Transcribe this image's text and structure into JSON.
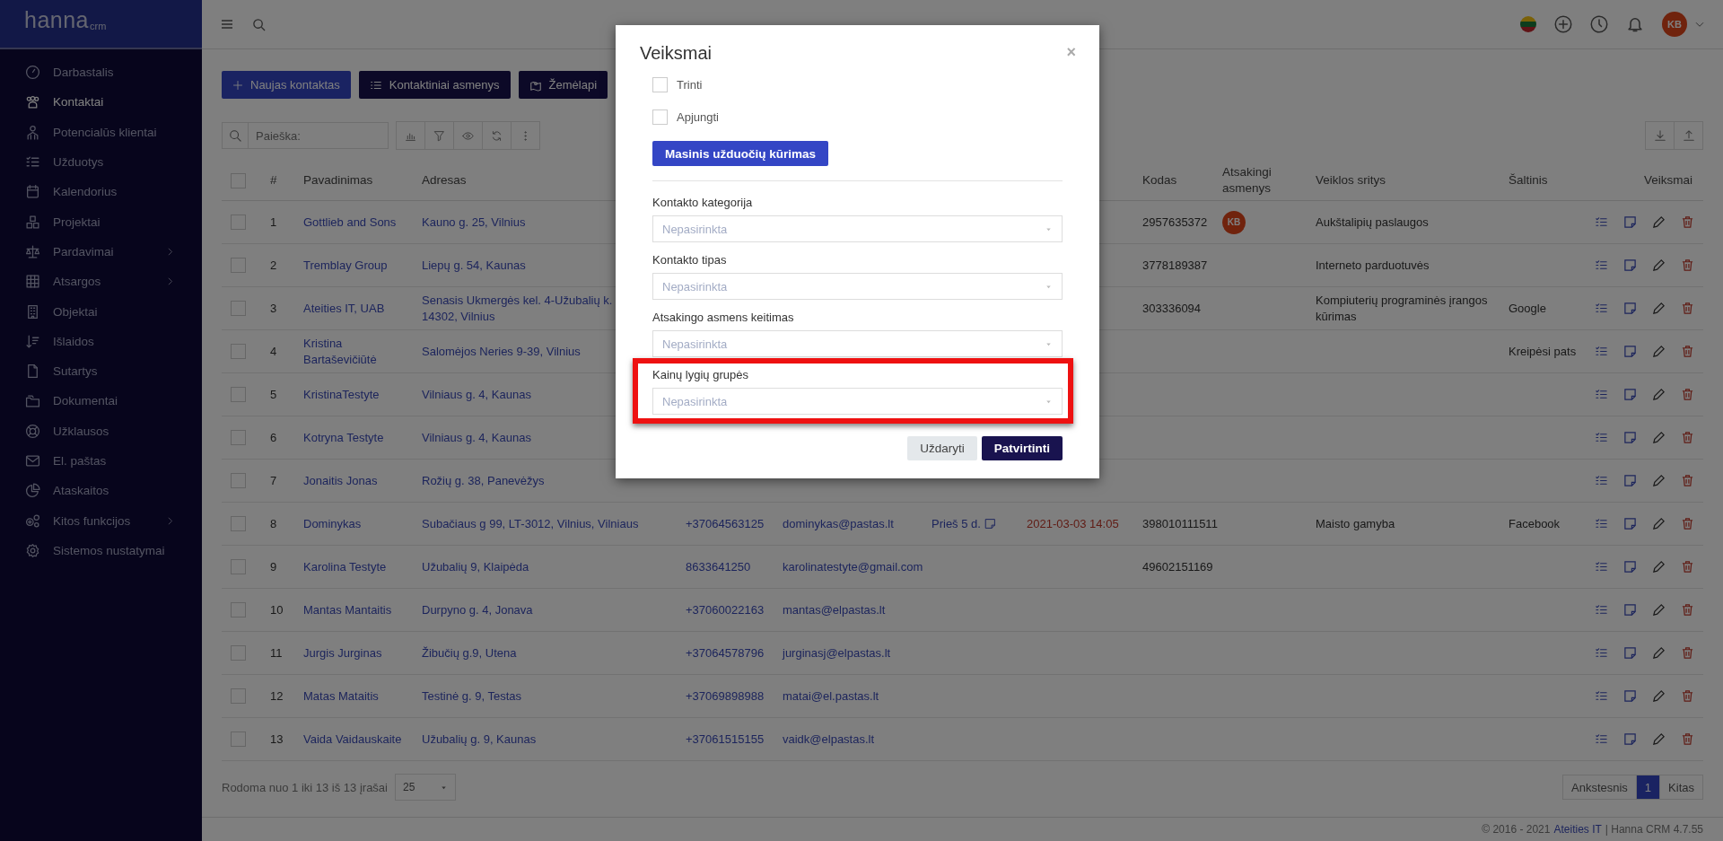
{
  "sidebar": {
    "logo": {
      "main": "hanna",
      "sub": "crm"
    },
    "items": [
      {
        "label": "Darbastalis",
        "selected": false,
        "has_submenu": false
      },
      {
        "label": "Kontaktai",
        "selected": true,
        "has_submenu": false
      },
      {
        "label": "Potencialūs klientai",
        "selected": false,
        "has_submenu": false
      },
      {
        "label": "Užduotys",
        "selected": false,
        "has_submenu": false
      },
      {
        "label": "Kalendorius",
        "selected": false,
        "has_submenu": false
      },
      {
        "label": "Projektai",
        "selected": false,
        "has_submenu": false
      },
      {
        "label": "Pardavimai",
        "selected": false,
        "has_submenu": true
      },
      {
        "label": "Atsargos",
        "selected": false,
        "has_submenu": true
      },
      {
        "label": "Objektai",
        "selected": false,
        "has_submenu": false
      },
      {
        "label": "Išlaidos",
        "selected": false,
        "has_submenu": false
      },
      {
        "label": "Sutartys",
        "selected": false,
        "has_submenu": false
      },
      {
        "label": "Dokumentai",
        "selected": false,
        "has_submenu": false
      },
      {
        "label": "Užklausos",
        "selected": false,
        "has_submenu": false
      },
      {
        "label": "El. paštas",
        "selected": false,
        "has_submenu": false
      },
      {
        "label": "Ataskaitos",
        "selected": false,
        "has_submenu": false
      },
      {
        "label": "Kitos funkcijos",
        "selected": false,
        "has_submenu": true
      },
      {
        "label": "Sistemos nustatymai",
        "selected": false,
        "has_submenu": false
      }
    ]
  },
  "topbar": {
    "user_initials": "KB"
  },
  "actions": [
    {
      "label": "Naujas kontaktas",
      "kind": "primary"
    },
    {
      "label": "Kontaktiniai asmenys",
      "kind": "dark"
    },
    {
      "label": "Žemėlapi",
      "kind": "dark"
    }
  ],
  "search": {
    "placeholder": "Paieška:"
  },
  "table": {
    "select_all_checked": false,
    "columns": [
      "",
      "#",
      "Pavadinimas",
      "Adresas",
      "",
      "",
      "",
      "",
      "Kodas",
      "Atsakingi asmenys",
      "Veiklos sritys",
      "Šaltinis",
      "Veiksmai"
    ],
    "rows": [
      {
        "checked": false,
        "num": "1",
        "name": "Gottlieb and Sons",
        "address": "Kauno g. 25, Vilnius",
        "code": "2957635372",
        "responsible": "KB",
        "activity": "Aukštalipių paslaugos"
      },
      {
        "checked": false,
        "num": "2",
        "name": "Tremblay Group",
        "address": "Liepų g. 54, Kaunas",
        "code": "3778189387",
        "activity": "Interneto parduotuvės"
      },
      {
        "checked": false,
        "num": "3",
        "name": "Ateities IT, UAB",
        "address": "Senasis Ukmergės kel. 4-Užubalių k.\n14302, Vilnius",
        "code": "303336094",
        "activity": "Kompiuterių programinės įrangos kūrimas",
        "source": "Google"
      },
      {
        "checked": false,
        "num": "4",
        "name": "Kristina Bartaševičiūtė",
        "address": "Salomėjos Neries 9-39, Vilnius",
        "source": "Kreipėsi pats"
      },
      {
        "checked": false,
        "num": "5",
        "name": "KristinaTestyte",
        "address": "Vilniaus g. 4, Kaunas"
      },
      {
        "checked": false,
        "num": "6",
        "name": "Kotryna Testyte",
        "address": "Vilniaus g. 4, Kaunas"
      },
      {
        "checked": false,
        "num": "7",
        "name": "Jonaitis Jonas",
        "address": "Rožių g. 38, Panevėžys"
      },
      {
        "checked": false,
        "num": "8",
        "name": "Dominykas",
        "address": "Subačiaus g 99, LT-3012, Vilnius, Vilniaus",
        "phone": "+37064563125",
        "email": "dominykas@pastas.lt",
        "last_contact": "Prieš 5 d.",
        "date": "2021-03-03 14:05",
        "code": "398010111511",
        "activity": "Maisto gamyba",
        "source": "Facebook"
      },
      {
        "checked": false,
        "num": "9",
        "name": "Karolina Testyte",
        "address": "Užubalių 9, Klaipėda",
        "phone": "8633641250",
        "email": "karolinatestyte@gmail.com",
        "code": "49602151169"
      },
      {
        "checked": false,
        "num": "10",
        "name": "Mantas Mantaitis",
        "address": "Durpyno g. 4, Jonava",
        "phone": "+37060022163",
        "email": "mantas@elpastas.lt"
      },
      {
        "checked": false,
        "num": "11",
        "name": "Jurgis Jurginas",
        "address": "Žibučių g.9, Utena",
        "phone": "+37064578796",
        "email": "jurginasj@elpastas.lt"
      },
      {
        "checked": false,
        "num": "12",
        "name": "Matas Mataitis",
        "address": "Testinė g. 9, Testas",
        "phone": "+37069898988",
        "email": "matai@el.pastas.lt"
      },
      {
        "checked": false,
        "num": "13",
        "name": "Vaida Vaidauskaite",
        "address": "Užubalių g. 9, Kaunas",
        "phone": "+37061515155",
        "email": "vaidk@elpastas.lt"
      }
    ]
  },
  "table_footer": {
    "info": "Rodoma nuo 1 iki 13 iš 13 įrašai",
    "page_size": "25"
  },
  "pagination": {
    "prev": "Ankstesnis",
    "pages": [
      {
        "label": "1",
        "selected": true
      }
    ],
    "next": "Kitas"
  },
  "footer": {
    "copyright": "© 2016 - 2021",
    "company": "Ateities IT",
    "product": "| Hanna CRM 4.7.55"
  },
  "modal": {
    "title": "Veiksmai",
    "close": "×",
    "checkboxes": [
      {
        "label": "Trinti",
        "checked": false
      },
      {
        "label": "Apjungti",
        "checked": false
      }
    ],
    "bulk_button": "Masinis užduočių kūrimas",
    "fields": [
      {
        "label": "Kontakto kategorija",
        "placeholder": "Nepasirinkta",
        "highlighted": false
      },
      {
        "label": "Kontakto tipas",
        "placeholder": "Nepasirinkta",
        "highlighted": false
      },
      {
        "label": "Atsakingo asmens keitimas",
        "placeholder": "Nepasirinkta",
        "highlighted": false
      },
      {
        "label": "Kainų lygių grupės",
        "placeholder": "Nepasirinkta",
        "highlighted": true
      }
    ],
    "buttons": [
      {
        "label": "Uždaryti",
        "kind": "secondary"
      },
      {
        "label": "Patvirtinti",
        "kind": "primary"
      }
    ]
  }
}
